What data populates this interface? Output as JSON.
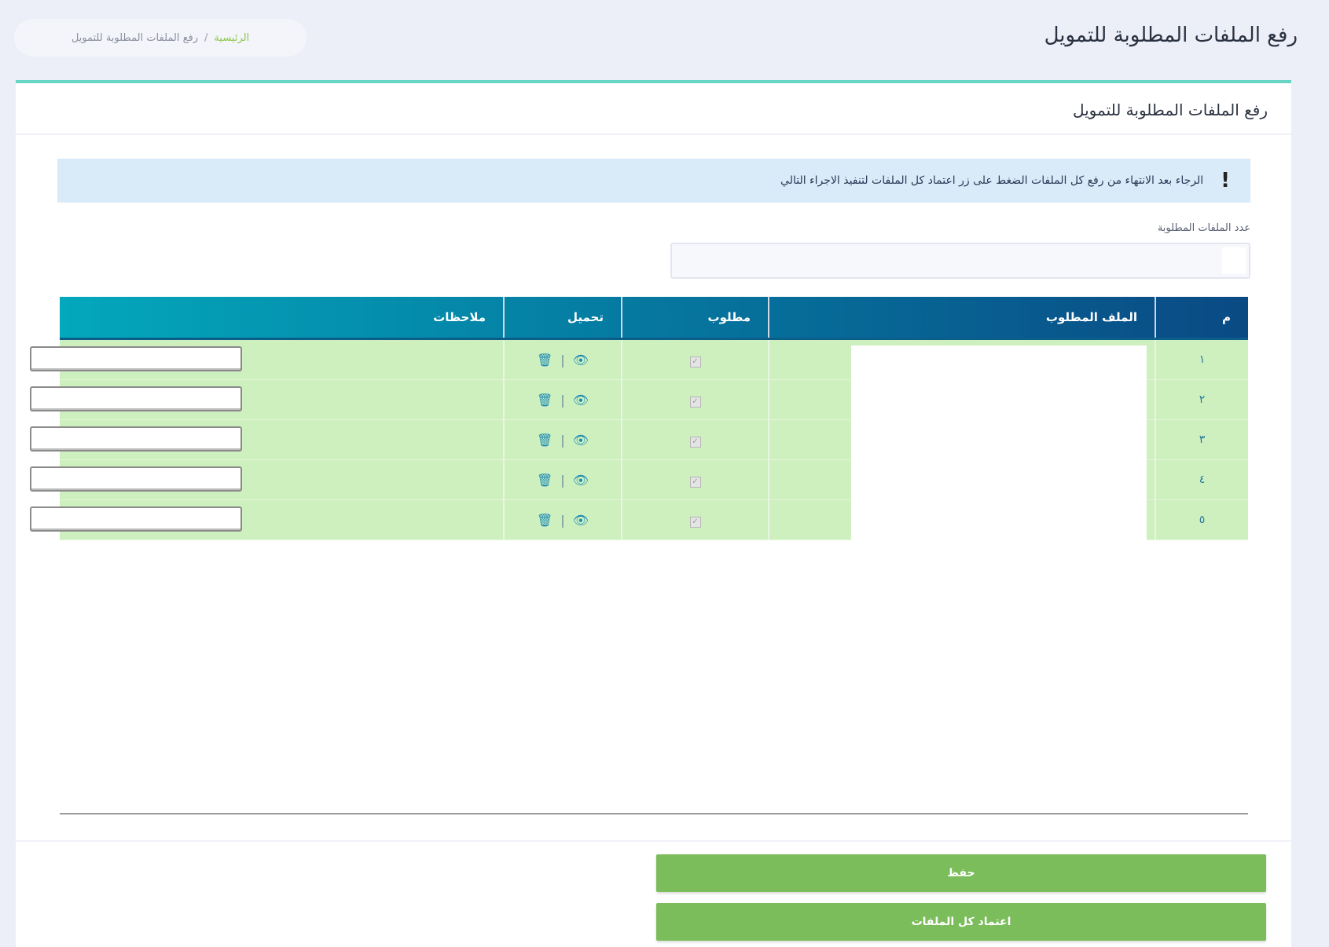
{
  "page": {
    "title": "رفع الملفات المطلوبة للتمويل"
  },
  "breadcrumb": {
    "home": "الرئيسية",
    "separator": "/",
    "current": "رفع الملفات المطلوبة للتمويل"
  },
  "card": {
    "header": "رفع الملفات المطلوبة للتمويل"
  },
  "alert": {
    "icon": "!",
    "text": "الرجاء بعد الانتهاء من رفع كل الملفات الضغط على زر اعتماد كل الملفات لتنفيذ الاجراء التالي"
  },
  "count_field": {
    "label": "عدد الملفات المطلوبة",
    "value": ""
  },
  "table": {
    "columns": [
      "م",
      "الملف المطلوب",
      "مطلوب",
      "تحميل",
      "ملاحظات"
    ],
    "rows": [
      {
        "num": "١",
        "required": true,
        "note": ""
      },
      {
        "num": "٢",
        "required": true,
        "note": ""
      },
      {
        "num": "٣",
        "required": true,
        "note": ""
      },
      {
        "num": "٤",
        "required": true,
        "note": ""
      },
      {
        "num": "٥",
        "required": true,
        "note": ""
      }
    ],
    "action_icons": {
      "view": "eye-icon",
      "separator": "|",
      "delete": "trash-icon"
    },
    "check_glyph": "✓",
    "eye_glyph": "👁",
    "trash_glyph": "🗑"
  },
  "buttons": {
    "save": "حفظ",
    "approve_all": "اعتماد كل الملفات"
  },
  "colors": {
    "accent_top": "#68d5c5",
    "row_green": "#cef0bf",
    "button_green": "#7bbd5b",
    "header_dark": "#0a4a84",
    "header_light": "#03a8bc"
  }
}
